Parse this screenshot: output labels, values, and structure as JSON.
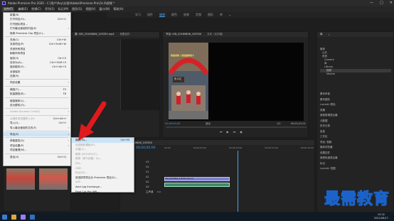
{
  "window": {
    "title": "Adobe Premiere Pro 2020 - C:\\用户\\Roy\\文档\\Adobe\\Premiere Pro\\14.0\\视频 *",
    "controls": [
      "—",
      "□",
      "✕"
    ]
  },
  "menubar": [
    "文件(F)",
    "编辑(E)",
    "剪辑(C)",
    "序列(S)",
    "标记(M)",
    "图形(G)",
    "视图(V)",
    "窗口(W)",
    "帮助(H)"
  ],
  "workspaces": [
    "学习",
    "组件",
    "编辑",
    "颜色",
    "效果",
    "音频",
    "图形",
    "库",
    "»"
  ],
  "file_menu": [
    {
      "label": "新建(N)",
      "sub": true
    },
    {
      "label": "打开项目(O)...",
      "shortcut": "Ctrl+O"
    },
    {
      "label": "打开团队项目...",
      "shortcut": ""
    },
    {
      "label": "打开最近使用的内容(E)",
      "sub": true
    },
    {
      "label": "转换 Premiere Clip 项目(C)...",
      "shortcut": ""
    },
    {
      "sep": true
    },
    {
      "label": "关闭(C)",
      "shortcut": "Ctrl+W"
    },
    {
      "label": "关闭项目(P)",
      "shortcut": "Ctrl+Shift+W"
    },
    {
      "label": "关闭所有项目",
      "shortcut": ""
    },
    {
      "label": "刷新所有项目",
      "shortcut": ""
    },
    {
      "label": "保存(S)",
      "shortcut": "Ctrl+S"
    },
    {
      "label": "另存为(A)...",
      "shortcut": "Ctrl+Shift+S"
    },
    {
      "label": "保存副本(Y)...",
      "shortcut": "Ctrl+Alt+S"
    },
    {
      "label": "全部保存",
      "shortcut": ""
    },
    {
      "label": "还原(R)",
      "shortcut": ""
    },
    {
      "sep": true
    },
    {
      "label": "同步设置",
      "sub": true
    },
    {
      "sep": true
    },
    {
      "label": "捕捉(T)...",
      "shortcut": "F5"
    },
    {
      "label": "批量捕捉(B)...",
      "shortcut": "F6"
    },
    {
      "sep": true
    },
    {
      "label": "链接媒体(L)...",
      "shortcut": ""
    },
    {
      "label": "设为脱机(O)...",
      "shortcut": ""
    },
    {
      "sep": true
    },
    {
      "label": "Adobe Dynamic Link(K)",
      "sub": true,
      "disabled": true
    },
    {
      "sep": true
    },
    {
      "label": "从媒体浏览器导入(M)",
      "shortcut": "Ctrl+Alt+I",
      "disabled": true
    },
    {
      "label": "导入(I)...",
      "shortcut": "Ctrl+I"
    },
    {
      "label": "导入最近使用的文件(F)",
      "sub": true
    },
    {
      "sep": true
    },
    {
      "label": "导出(E)",
      "sub": true,
      "highlight": true
    },
    {
      "sep": true
    },
    {
      "label": "获取属性(G)",
      "sub": true
    },
    {
      "label": "项目设置(P)",
      "sub": true
    },
    {
      "label": "项目管理(M)...",
      "shortcut": ""
    },
    {
      "sep": true
    },
    {
      "label": "退出(X)",
      "shortcut": "Ctrl+Q"
    }
  ],
  "export_submenu": [
    {
      "label": "媒体(M)...",
      "shortcut": "Ctrl+M",
      "highlight": true
    },
    {
      "label": "动态图形模板(R)...",
      "disabled": true
    },
    {
      "label": "字幕(C)...",
      "disabled": true
    },
    {
      "label": "磁带 (DV/HDV)(T)...",
      "disabled": true
    },
    {
      "label": "磁带（串行设备）(S)...",
      "disabled": true
    },
    {
      "label": "EDL...",
      "disabled": true
    },
    {
      "label": "OMF...",
      "disabled": true
    },
    {
      "label": "标记(M)...",
      "disabled": true
    },
    {
      "label": "将选择项导出为 Premiere 项目(S)...",
      "disabled": false
    },
    {
      "label": "AAF...",
      "disabled": true
    },
    {
      "label": "Avid Log Exchange...",
      "disabled": false
    },
    {
      "label": "Final Cut Pro XML...",
      "disabled": false
    }
  ],
  "source_panel": {
    "tabs": [
      "源: VID_20160806_103350.mp4",
      "效果控件",
      "Lumetri 范围",
      "音频剪辑混合器: VID_20160806_103350"
    ]
  },
  "program_panel": {
    "tabs": [
      "节目: VID_20160806_103350",
      "文本（无字幕）"
    ],
    "timecode_left": "00;00;00;00",
    "fit": "适合",
    "ratio": "1/2",
    "timecode_right": "00;00;23;01"
  },
  "timeline": {
    "sequence_tab": "VID_20160806_103350",
    "timecode": "00;00;00;00",
    "ruler": [
      "00;00",
      "00;00;05;00",
      "00;00;10;00",
      "00;00;15;00",
      "00;00;20;00"
    ],
    "tracks": [
      "V3",
      "V2",
      "V1",
      "A1",
      "A2",
      "A3",
      "主声道"
    ],
    "clip_label": "VID_20160806_103350.mp4 [V]",
    "master_value": "0.0"
  },
  "right_panel": {
    "tabs": [
      "库",
      "»"
    ],
    "tree": [
      "媒体",
      "公共",
      "系统",
      "Camera",
      "库",
      "Library",
      "视频",
      "Movies",
      "(E)",
      "新建"
    ],
    "list": [
      "基本声音",
      "基本图形",
      "Lumetri 颜色",
      "效果",
      "音频剪辑混合器",
      "元数据",
      "历史记录",
      "信息",
      "工作区",
      "项目: 视频",
      "媒体浏览器",
      "效果控件",
      "音频轨道混合器",
      "标记",
      "Lumetri 范围"
    ]
  },
  "sign_text": "恭喜发财 | 谁是最帅的人",
  "shop_sign": "乐人汇",
  "watermark": "最需教育",
  "taskbar": {
    "time": "15:32",
    "date": "2021/08/17"
  },
  "colors": {
    "highlight": "#cce4f7",
    "timeline_blue": "#4a9fe8",
    "arrow": "#e0191c"
  }
}
